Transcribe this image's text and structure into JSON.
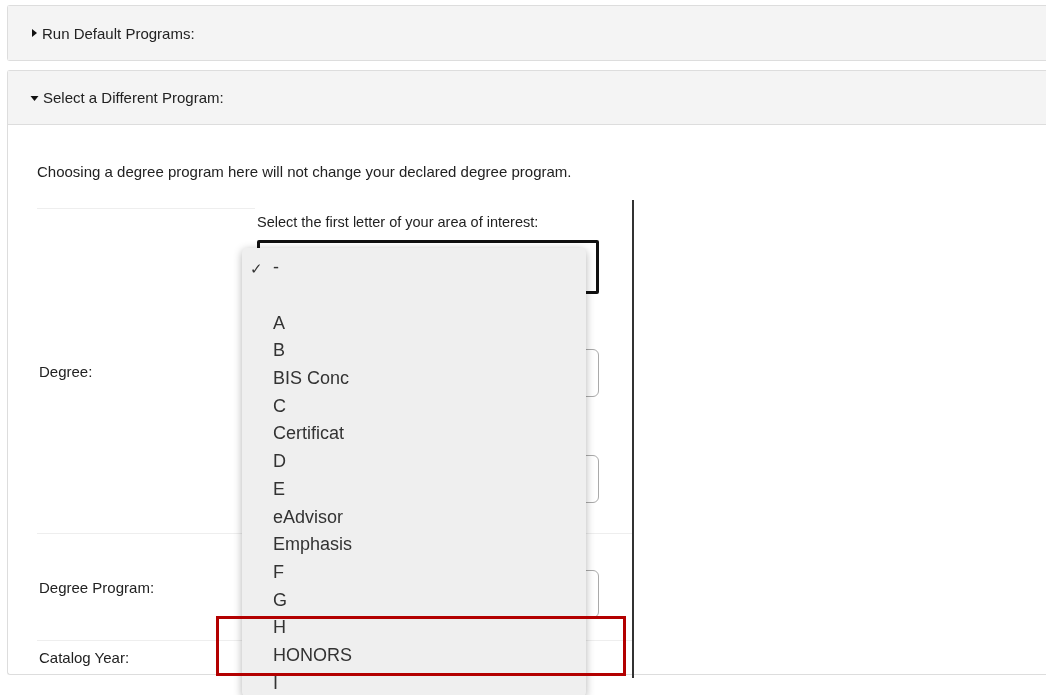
{
  "panels": [
    {
      "title": "Run Default Programs:",
      "expanded": false
    },
    {
      "title": "Select a Different Program:",
      "expanded": true
    }
  ],
  "notice": "Choosing a degree program here will not change your declared degree program.",
  "form": {
    "rows": [
      {
        "label": "Degree:",
        "prompt": "Select the first letter of your area of interest:"
      },
      {
        "label": "Degree Program:"
      },
      {
        "label": "Catalog Year:"
      }
    ]
  },
  "dropdown": {
    "check_mark": "✓",
    "items": [
      {
        "label": "-",
        "checked": true,
        "gap_after": true
      },
      {
        "label": "A",
        "checked": false
      },
      {
        "label": "B",
        "checked": false
      },
      {
        "label": "BIS Conc",
        "checked": false
      },
      {
        "label": "C",
        "checked": false
      },
      {
        "label": "Certificat",
        "checked": false
      },
      {
        "label": "D",
        "checked": false
      },
      {
        "label": "E",
        "checked": false
      },
      {
        "label": "eAdvisor",
        "checked": false
      },
      {
        "label": "Emphasis",
        "checked": false
      },
      {
        "label": "F",
        "checked": false
      },
      {
        "label": "G",
        "checked": false
      },
      {
        "label": "H",
        "checked": false
      },
      {
        "label": "HONORS",
        "checked": false
      },
      {
        "label": "I",
        "checked": false
      }
    ]
  }
}
